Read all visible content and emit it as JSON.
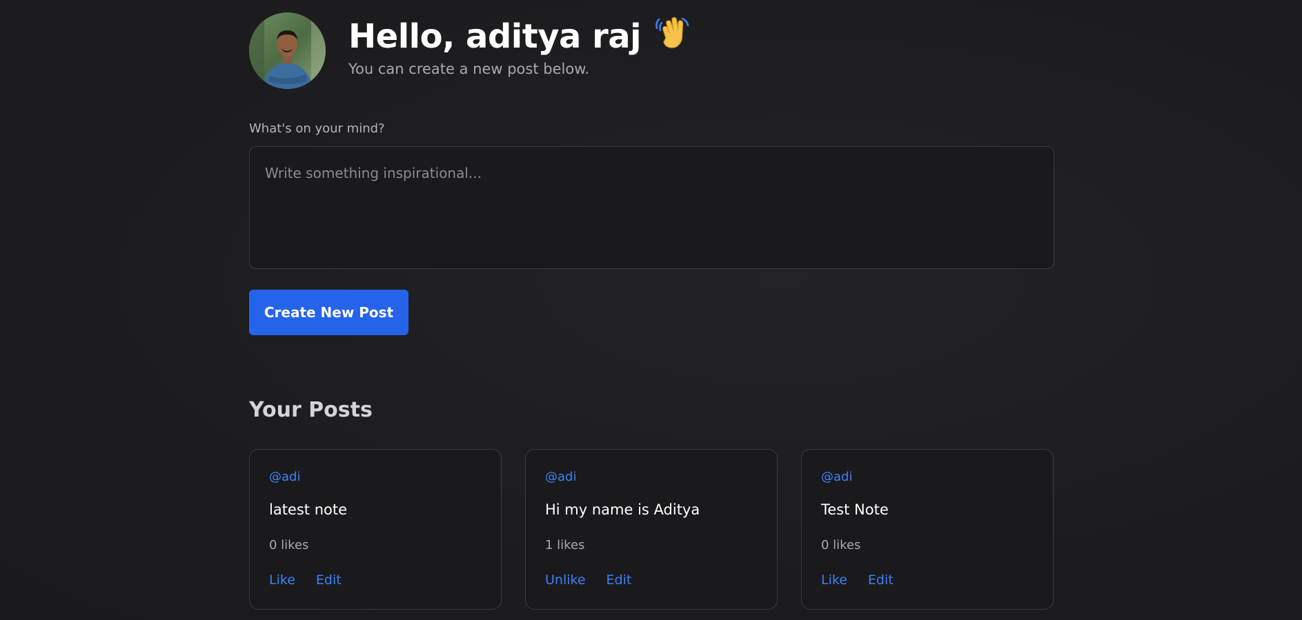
{
  "header": {
    "greeting": "Hello, aditya raj",
    "wave_emoji": "wave-icon",
    "subtitle": "You can create a new post below."
  },
  "composer": {
    "label": "What's on your mind?",
    "placeholder": "Write something inspirational...",
    "value": "",
    "submit_label": "Create New Post"
  },
  "posts_section": {
    "title": "Your Posts",
    "posts": [
      {
        "author": "@adi",
        "content": "latest note",
        "likes_text": "0 likes",
        "like_action": "Like",
        "edit_action": "Edit"
      },
      {
        "author": "@adi",
        "content": "Hi my name is Aditya",
        "likes_text": "1 likes",
        "like_action": "Unlike",
        "edit_action": "Edit"
      },
      {
        "author": "@adi",
        "content": "Test Note",
        "likes_text": "0 likes",
        "like_action": "Like",
        "edit_action": "Edit"
      }
    ]
  },
  "colors": {
    "background": "#1d1d20",
    "accent": "#2563eb",
    "link": "#3b82f6",
    "card_border": "#3a3a3f"
  }
}
